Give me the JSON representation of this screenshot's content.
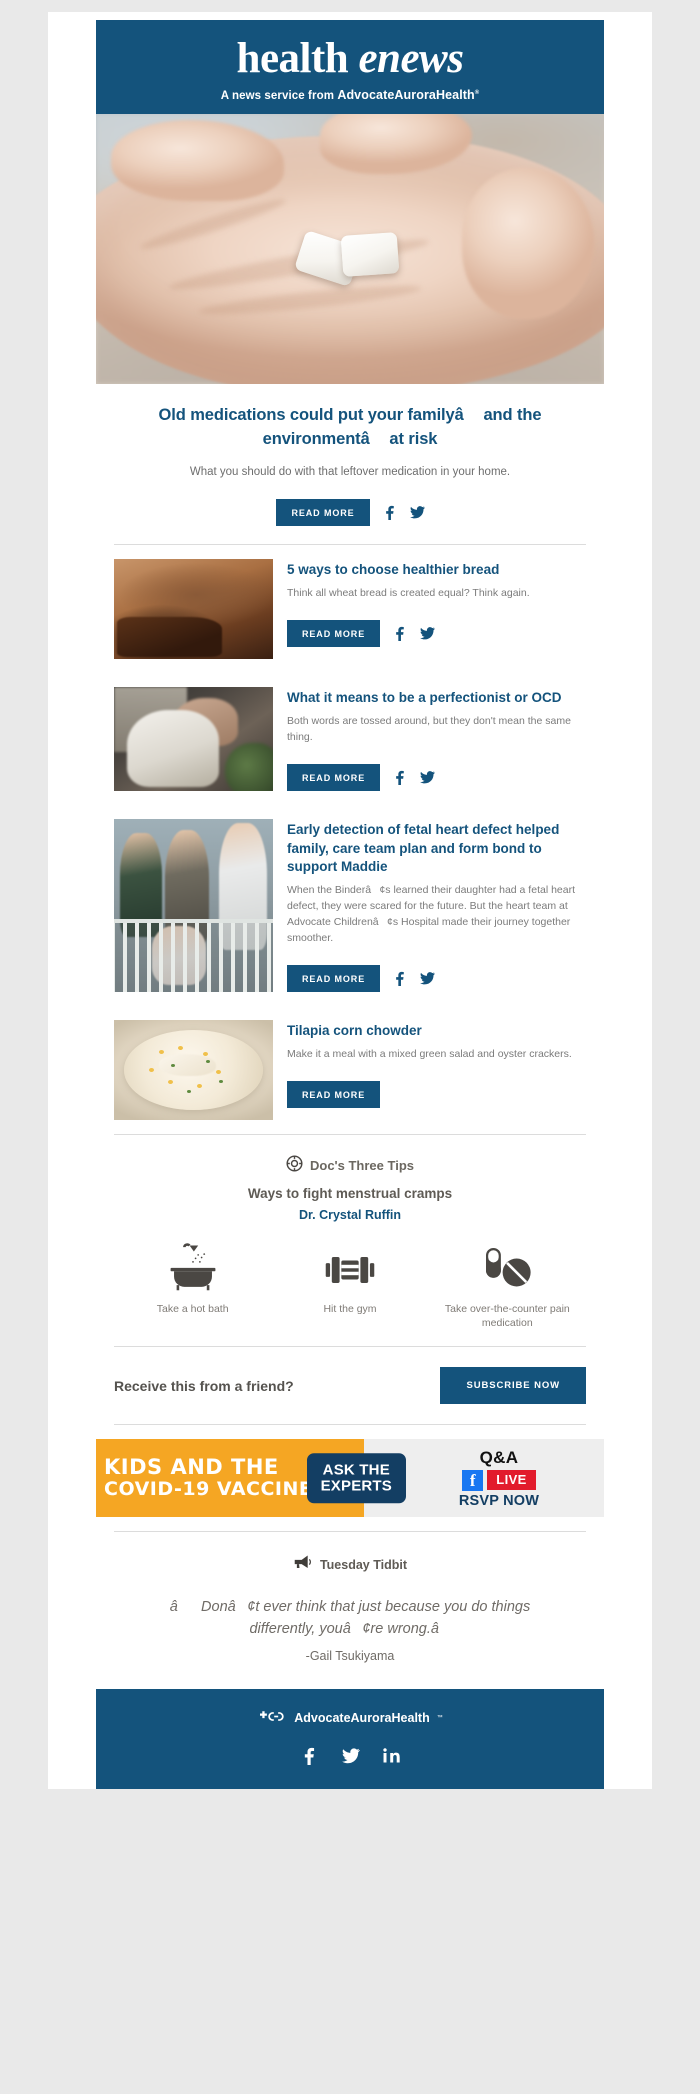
{
  "masthead": {
    "title_regular": "health ",
    "title_italic": "enews",
    "tagline_prefix": "A news service from ",
    "tagline_brand": "AdvocateAuroraHealth",
    "tagline_mark": "®"
  },
  "hero": {
    "alt": "hand-holding-pills-photo"
  },
  "lead_story": {
    "title": "Old medications could put your familyâand the environmentâat risk",
    "description": "What you should do with that leftover medication in your home.",
    "read_more_label": "READ MORE",
    "facebook_icon": "facebook-icon",
    "twitter_icon": "twitter-icon"
  },
  "articles": [
    {
      "thumb": "bread-loaf-photo",
      "title": "5 ways to choose healthier bread",
      "description": "Think all wheat bread is created equal? Think again.",
      "read_more_label": "READ MORE",
      "has_social": true
    },
    {
      "thumb": "parent-and-child-kitchen-photo",
      "title": "What it means to be a perfectionist or OCD",
      "description": "Both words are tossed around, but they don't mean the same thing.",
      "read_more_label": "READ MORE",
      "has_social": true
    },
    {
      "thumb": "family-with-doctor-at-crib-photo",
      "title": "Early detection of fetal heart defect helped family, care team plan and form bond to support Maddie",
      "description": "When the Binderâ¢s learned their daughter had a fetal heart defect, they were scared for the future. But the heart team at Advocate Childrenâ¢s Hospital made their journey together smoother.",
      "read_more_label": "READ MORE",
      "has_social": true
    },
    {
      "thumb": "tilapia-corn-chowder-photo",
      "title": "Tilapia corn chowder",
      "description": "Make it a meal with a mixed green salad and oyster crackers.",
      "read_more_label": "READ MORE",
      "has_social": false
    }
  ],
  "doc_tips": {
    "badge_icon": "life-preserver-icon",
    "heading": "Doc's Three Tips",
    "subheading": "Ways to fight menstrual cramps",
    "doctor": "Dr. Crystal Ruffin",
    "tips": [
      {
        "icon": "bathtub-shower-icon",
        "label": "Take a hot bath"
      },
      {
        "icon": "dumbbell-icon",
        "label": "Hit the gym"
      },
      {
        "icon": "pills-capsule-icon",
        "label": "Take over-the-counter pain medication"
      }
    ]
  },
  "subscribe": {
    "prompt": "Receive this from a friend?",
    "button_label": "SUBSCRIBE NOW"
  },
  "ad": {
    "kicker_line1": "KIDS AND THE",
    "kicker_line2": "COVID-19 VACCINE",
    "chip_line1": "ASK THE",
    "chip_line2": "EXPERTS",
    "qa_title": "Q&A",
    "facebook_glyph": "f",
    "facebook_icon": "facebook-square-icon",
    "live_label": "LIVE",
    "rsvp_label": "RSVP NOW"
  },
  "tidbit": {
    "icon": "megaphone-icon",
    "label": "Tuesday Tidbit",
    "quote": "âDonâ¢t ever think that just because you do things differently, youâ¢re wrong.â",
    "author": "-Gail Tsukiyama"
  },
  "footer": {
    "logo_icon": "advocate-aurora-logo-icon",
    "brand": "AdvocateAuroraHealth",
    "brand_mark": "™",
    "social": [
      {
        "icon": "facebook-icon",
        "name": "facebook"
      },
      {
        "icon": "twitter-icon",
        "name": "twitter"
      },
      {
        "icon": "linkedin-icon",
        "name": "linkedin"
      }
    ]
  },
  "colors": {
    "brand_blue": "#14537c",
    "ad_orange": "#f5a623",
    "live_red": "#e21b2c",
    "facebook_blue": "#1877f2",
    "page_bg": "#e9e9e9"
  }
}
